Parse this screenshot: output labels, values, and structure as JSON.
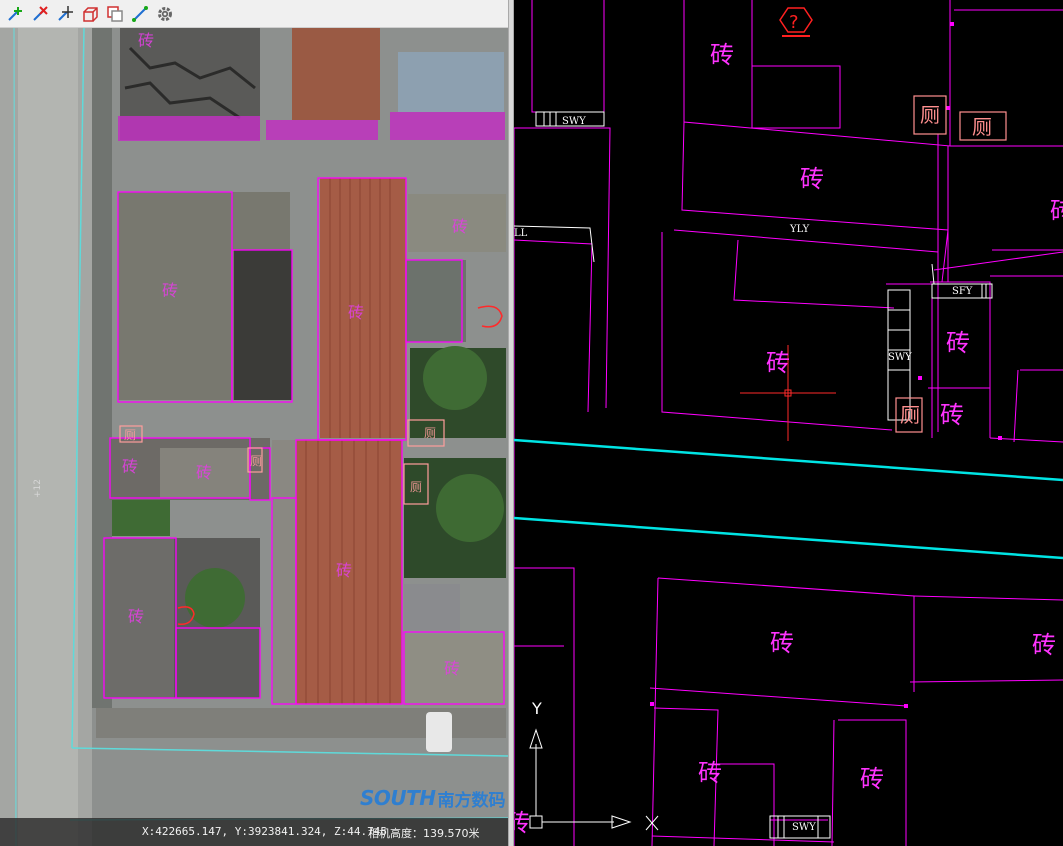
{
  "toolbar": {
    "tools": [
      {
        "icon": "add-point-icon"
      },
      {
        "icon": "delete-point-icon"
      },
      {
        "icon": "move-point-icon"
      },
      {
        "icon": "3d-box-icon"
      },
      {
        "icon": "copy-frame-icon"
      },
      {
        "icon": "measure-line-icon"
      },
      {
        "icon": "settings-gear-icon"
      }
    ]
  },
  "aerial_view": {
    "overlay_labels": [
      "砖",
      "砖",
      "砖",
      "砖",
      "砖",
      "砖",
      "砖",
      "砖",
      "砖",
      "厕",
      "厕",
      "厕",
      "厕"
    ],
    "logo_text": "SOUTH",
    "logo_text_cn": "南方数码",
    "status": {
      "coords": "X:422665.147, Y:3923841.324, Z:44.745",
      "camera_height": "相机高度：139.570米"
    }
  },
  "cad_view": {
    "building_labels": [
      "砖",
      "砖",
      "砖",
      "砖",
      "砖",
      "砖",
      "砖",
      "砖",
      "砖",
      "砖",
      "砖"
    ],
    "toilet_labels": [
      "厕",
      "厕",
      "厕"
    ],
    "codes": [
      "SWY",
      "YLY",
      "LL",
      "SFY",
      "SWY",
      "SWY"
    ],
    "ucs": {
      "y_label": "Y",
      "x_label": "X"
    }
  },
  "colors": {
    "building_outline": "#ff00ff",
    "road_line": "#00e5e5",
    "toilet": "#ff8f8f",
    "cursor": "#ff2a2a"
  }
}
